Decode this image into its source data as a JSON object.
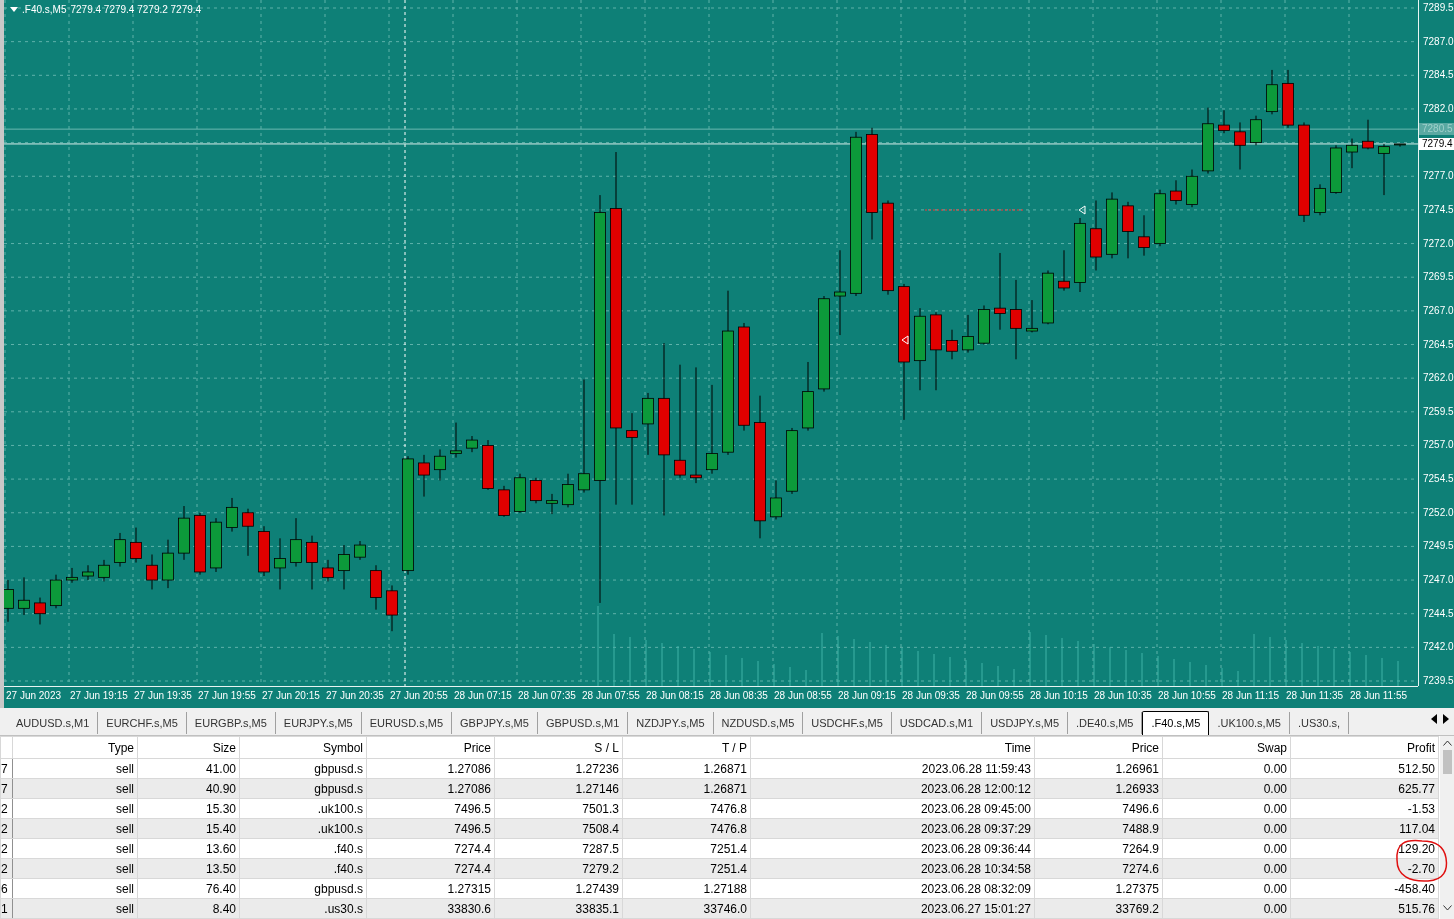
{
  "chart": {
    "symbol": ".F40.s,M5",
    "quote": "7279.4 7279.4 7279.2 7279.4",
    "chart_data": {
      "type": "candlestick",
      "grid": true,
      "ref_lines": [
        {
          "axis": "y",
          "value": 7280.5,
          "color": "#6cb8b1"
        },
        {
          "axis": "y",
          "value": 7279.4,
          "color": "#d8ecea"
        }
      ],
      "categories": [
        null,
        null,
        null,
        null,
        null,
        null,
        null,
        null,
        null,
        null,
        null,
        null,
        null,
        null,
        null,
        null,
        null,
        null,
        null,
        null,
        null,
        null,
        null,
        null,
        null,
        null,
        null,
        null,
        null,
        null,
        null,
        null,
        null,
        null,
        null,
        null,
        null,
        null,
        null,
        null,
        null,
        null,
        null,
        null,
        null,
        null,
        null,
        null,
        null,
        null,
        null,
        null,
        null,
        null,
        null,
        null,
        null,
        null,
        null,
        null,
        null,
        null,
        null,
        null,
        null,
        null,
        null,
        null,
        null,
        null,
        null,
        null,
        null,
        null,
        null,
        null,
        null,
        null,
        null,
        null,
        null,
        null,
        null,
        null,
        null,
        null,
        null,
        null
      ],
      "ylim": [
        7239.5,
        7289.5
      ],
      "yticks": [
        {
          "value": 7289.5,
          "label": "7289.5"
        },
        {
          "value": 7287,
          "label": "7287.0"
        },
        {
          "value": 7284.5,
          "label": "7284.5"
        },
        {
          "value": 7282,
          "label": "7282.0"
        },
        {
          "value": 7277,
          "label": "7277.0"
        },
        {
          "value": 7274.5,
          "label": "7274.5"
        },
        {
          "value": 7272,
          "label": "7272.0"
        },
        {
          "value": 7269.5,
          "label": "7269.5"
        },
        {
          "value": 7267,
          "label": "7267.0"
        },
        {
          "value": 7264.5,
          "label": "7264.5"
        },
        {
          "value": 7262,
          "label": "7262.0"
        },
        {
          "value": 7259.5,
          "label": "7259.5"
        },
        {
          "value": 7257,
          "label": "7257.0"
        },
        {
          "value": 7254.5,
          "label": "7254.5"
        },
        {
          "value": 7252,
          "label": "7252.0"
        },
        {
          "value": 7249.5,
          "label": "7249.5"
        },
        {
          "value": 7247,
          "label": "7247.0"
        },
        {
          "value": 7244.5,
          "label": "7244.5"
        },
        {
          "value": 7242,
          "label": "7242.0"
        },
        {
          "value": 7239.5,
          "label": "7239.5"
        }
      ],
      "ohlc": [
        [
          7244.9,
          7247.0,
          7243.9,
          7246.3
        ],
        [
          7244.9,
          7247.2,
          7244.4,
          7245.5
        ],
        [
          7245.3,
          7245.7,
          7243.7,
          7244.5
        ],
        [
          7245.1,
          7247.4,
          7244.9,
          7247.0
        ],
        [
          7247.0,
          7247.9,
          7246.8,
          7247.2
        ],
        [
          7247.3,
          7248.1,
          7247.0,
          7247.6
        ],
        [
          7247.2,
          7248.5,
          7246.9,
          7248.1
        ],
        [
          7248.3,
          7250.5,
          7248.0,
          7250.0
        ],
        [
          7249.8,
          7250.9,
          7248.3,
          7248.6
        ],
        [
          7248.1,
          7248.9,
          7246.3,
          7247.0
        ],
        [
          7247.0,
          7250.0,
          7246.4,
          7249.0
        ],
        [
          7249.0,
          7252.5,
          7248.5,
          7251.6
        ],
        [
          7251.8,
          7252.0,
          7247.4,
          7247.6
        ],
        [
          7247.9,
          7251.6,
          7247.6,
          7251.3
        ],
        [
          7250.9,
          7253.1,
          7250.6,
          7252.4
        ],
        [
          7252.0,
          7252.3,
          7248.8,
          7251.0
        ],
        [
          7250.6,
          7251.0,
          7247.3,
          7247.6
        ],
        [
          7247.9,
          7250.1,
          7246.3,
          7248.6
        ],
        [
          7248.3,
          7251.6,
          7248.0,
          7250.0
        ],
        [
          7249.8,
          7250.3,
          7246.3,
          7248.3
        ],
        [
          7247.9,
          7248.5,
          7246.9,
          7247.2
        ],
        [
          7247.7,
          7249.6,
          7246.3,
          7248.9
        ],
        [
          7248.7,
          7249.9,
          7248.5,
          7249.6
        ],
        [
          7247.7,
          7248.1,
          7244.8,
          7245.7
        ],
        [
          7246.2,
          7246.6,
          7243.2,
          7244.4
        ],
        [
          7247.7,
          7256.2,
          7247.4,
          7256.0
        ],
        [
          7255.7,
          7256.3,
          7253.2,
          7254.8
        ],
        [
          7255.2,
          7256.7,
          7254.4,
          7256.2
        ],
        [
          7256.4,
          7258.7,
          7256.1,
          7256.6
        ],
        [
          7256.8,
          7257.7,
          7256.5,
          7257.4
        ],
        [
          7257.0,
          7257.4,
          7253.7,
          7253.8
        ],
        [
          7253.7,
          7254.0,
          7251.7,
          7251.8
        ],
        [
          7252.1,
          7254.9,
          7252.0,
          7254.6
        ],
        [
          7254.4,
          7254.6,
          7252.7,
          7252.9
        ],
        [
          7252.7,
          7253.4,
          7251.9,
          7252.9
        ],
        [
          7252.6,
          7254.9,
          7252.4,
          7254.1
        ],
        [
          7253.7,
          7261.9,
          7253.5,
          7254.9
        ],
        [
          7254.4,
          7275.6,
          7245.3,
          7274.3
        ],
        [
          7274.6,
          7278.8,
          7252.6,
          7258.3
        ],
        [
          7258.1,
          7259.4,
          7252.6,
          7257.6
        ],
        [
          7258.6,
          7260.9,
          7256.3,
          7260.5
        ],
        [
          7260.5,
          7264.6,
          7251.8,
          7256.3
        ],
        [
          7255.9,
          7263.0,
          7254.6,
          7254.8
        ],
        [
          7254.8,
          7262.8,
          7254.2,
          7254.6
        ],
        [
          7255.2,
          7261.5,
          7254.9,
          7256.4
        ],
        [
          7256.5,
          7268.5,
          7256.3,
          7265.5
        ],
        [
          7265.8,
          7266.1,
          7258.1,
          7258.5
        ],
        [
          7258.7,
          7260.7,
          7250.1,
          7251.4
        ],
        [
          7251.7,
          7254.4,
          7251.5,
          7253.1
        ],
        [
          7253.6,
          7258.3,
          7253.4,
          7258.1
        ],
        [
          7258.3,
          7263.2,
          7258.1,
          7261.0
        ],
        [
          7261.2,
          7268.1,
          7261.0,
          7267.9
        ],
        [
          7268.1,
          7271.5,
          7265.2,
          7268.4
        ],
        [
          7268.3,
          7280.3,
          7268.1,
          7279.9
        ],
        [
          7280.1,
          7280.6,
          7272.3,
          7274.3
        ],
        [
          7275.0,
          7275.2,
          7268.2,
          7268.5
        ],
        [
          7268.8,
          7269.0,
          7258.9,
          7263.2
        ],
        [
          7263.3,
          7267.2,
          7261.1,
          7266.6
        ],
        [
          7266.7,
          7266.9,
          7261.1,
          7264.1
        ],
        [
          7264.8,
          7265.6,
          7263.4,
          7264.0
        ],
        [
          7264.1,
          7266.7,
          7263.9,
          7265.1
        ],
        [
          7264.6,
          7267.4,
          7264.5,
          7267.1
        ],
        [
          7267.2,
          7271.3,
          7265.6,
          7266.8
        ],
        [
          7267.1,
          7269.3,
          7263.4,
          7265.7
        ],
        [
          7265.5,
          7267.8,
          7265.4,
          7265.7
        ],
        [
          7266.1,
          7270.0,
          7266.0,
          7269.8
        ],
        [
          7269.2,
          7271.5,
          7268.5,
          7268.7
        ],
        [
          7269.1,
          7273.9,
          7268.4,
          7273.5
        ],
        [
          7273.1,
          7275.2,
          7270.0,
          7271.0
        ],
        [
          7271.2,
          7275.8,
          7270.9,
          7275.3
        ],
        [
          7274.8,
          7275.1,
          7270.9,
          7272.9
        ],
        [
          7272.5,
          7274.1,
          7271.1,
          7271.7
        ],
        [
          7272.0,
          7276.0,
          7271.8,
          7275.7
        ],
        [
          7275.9,
          7276.7,
          7274.9,
          7275.2
        ],
        [
          7274.9,
          7277.5,
          7274.7,
          7277.0
        ],
        [
          7277.4,
          7282.1,
          7277.2,
          7280.9
        ],
        [
          7280.8,
          7281.9,
          7280.2,
          7280.4
        ],
        [
          7280.3,
          7281.0,
          7277.5,
          7279.3
        ],
        [
          7279.5,
          7281.5,
          7279.3,
          7281.2
        ],
        [
          7281.8,
          7284.9,
          7281.6,
          7283.8
        ],
        [
          7283.9,
          7284.9,
          7280.6,
          7280.8
        ],
        [
          7280.8,
          7281.0,
          7273.6,
          7274.1
        ],
        [
          7274.3,
          7276.4,
          7274.1,
          7276.1
        ],
        [
          7275.8,
          7279.3,
          7275.7,
          7279.1
        ],
        [
          7278.8,
          7279.8,
          7277.6,
          7279.3
        ],
        [
          7279.6,
          7281.2,
          7279.0,
          7279.1
        ],
        [
          7278.7,
          7279.4,
          7275.6,
          7279.2
        ],
        [
          7279.4,
          7279.4,
          7279.2,
          7279.4
        ]
      ]
    },
    "price_tags": [
      {
        "text": "7280.5",
        "kind": "ask"
      },
      {
        "text": "7279.4",
        "kind": "bid"
      }
    ],
    "time_axis": [
      "27 Jun 2023",
      "27 Jun 19:15",
      "27 Jun 19:35",
      "27 Jun 19:55",
      "27 Jun 20:15",
      "27 Jun 20:35",
      "27 Jun 20:55",
      "28 Jun 07:15",
      "28 Jun 07:35",
      "28 Jun 07:55",
      "28 Jun 08:15",
      "28 Jun 08:35",
      "28 Jun 08:55",
      "28 Jun 09:15",
      "28 Jun 09:35",
      "28 Jun 09:55",
      "28 Jun 10:15",
      "28 Jun 10:35",
      "28 Jun 10:55",
      "28 Jun 11:15",
      "28 Jun 11:35",
      "28 Jun 11:55"
    ]
  },
  "tabs": [
    {
      "label": "AUDUSD.s,M1",
      "selected": false
    },
    {
      "label": "EURCHF.s,M5",
      "selected": false
    },
    {
      "label": "EURGBP.s,M5",
      "selected": false
    },
    {
      "label": "EURJPY.s,M5",
      "selected": false
    },
    {
      "label": "EURUSD.s,M5",
      "selected": false
    },
    {
      "label": "GBPJPY.s,M5",
      "selected": false
    },
    {
      "label": "GBPUSD.s,M1",
      "selected": false
    },
    {
      "label": "NZDJPY.s,M5",
      "selected": false
    },
    {
      "label": "NZDUSD.s,M5",
      "selected": false
    },
    {
      "label": "USDCHF.s,M5",
      "selected": false
    },
    {
      "label": "USDCAD.s,M1",
      "selected": false
    },
    {
      "label": "USDJPY.s,M5",
      "selected": false
    },
    {
      "label": ".DE40.s,M5",
      "selected": false
    },
    {
      "label": ".F40.s,M5",
      "selected": true
    },
    {
      "label": ".UK100.s,M5",
      "selected": false
    },
    {
      "label": ".US30.s,",
      "selected": false
    }
  ],
  "table": {
    "columns": [
      "",
      "Type",
      "Size",
      "Symbol",
      "Price",
      "S / L",
      "T / P",
      "Time",
      "Price",
      "Swap",
      "Profit"
    ],
    "rows": [
      {
        "cells": [
          "7",
          "sell",
          "41.00",
          "gbpusd.s",
          "1.27086",
          "1.27236",
          "1.26871",
          "2023.06.28 11:59:43",
          "1.26961",
          "0.00",
          "512.50"
        ]
      },
      {
        "cells": [
          "7",
          "sell",
          "40.90",
          "gbpusd.s",
          "1.27086",
          "1.27146",
          "1.26871",
          "2023.06.28 12:00:12",
          "1.26933",
          "0.00",
          "625.77"
        ]
      },
      {
        "cells": [
          "2",
          "sell",
          "15.30",
          ".uk100.s",
          "7496.5",
          "7501.3",
          "7476.8",
          "2023.06.28 09:45:00",
          "7496.6",
          "0.00",
          "-1.53"
        ]
      },
      {
        "cells": [
          "2",
          "sell",
          "15.40",
          ".uk100.s",
          "7496.5",
          "7508.4",
          "7476.8",
          "2023.06.28 09:37:29",
          "7488.9",
          "0.00",
          "117.04"
        ]
      },
      {
        "cells": [
          "2",
          "sell",
          "13.60",
          ".f40.s",
          "7274.4",
          "7287.5",
          "7251.4",
          "2023.06.28 09:36:44",
          "7264.9",
          "0.00",
          "129.20"
        ]
      },
      {
        "cells": [
          "2",
          "sell",
          "13.50",
          ".f40.s",
          "7274.4",
          "7279.2",
          "7251.4",
          "2023.06.28 10:34:58",
          "7274.6",
          "0.00",
          "-2.70"
        ]
      },
      {
        "cells": [
          "6",
          "sell",
          "76.40",
          "gbpusd.s",
          "1.27315",
          "1.27439",
          "1.27188",
          "2023.06.28 08:32:09",
          "1.27375",
          "0.00",
          "-458.40"
        ]
      },
      {
        "cells": [
          "1",
          "sell",
          "8.40",
          ".us30.s",
          "33830.6",
          "33835.1",
          "33746.0",
          "2023.06.27 15:01:27",
          "33769.2",
          "0.00",
          "515.76"
        ]
      }
    ]
  }
}
